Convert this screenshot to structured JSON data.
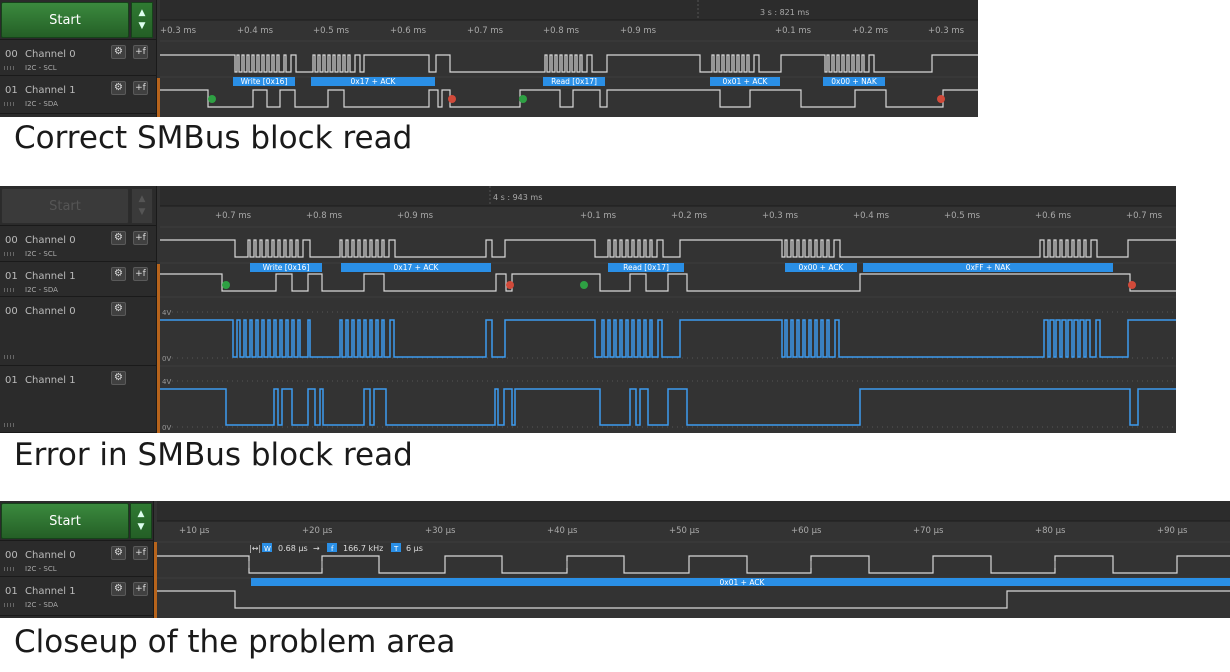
{
  "panel1": {
    "start_label": "Start",
    "timestamp": "3 s : 821 ms",
    "ticks": [
      "+0.3 ms",
      "+0.4 ms",
      "+0.5 ms",
      "+0.6 ms",
      "+0.7 ms",
      "+0.8 ms",
      "+0.9 ms",
      "+0.1 ms",
      "+0.2 ms",
      "+0.3 ms"
    ],
    "channels": [
      {
        "num": "00",
        "name": "Channel 0",
        "sub": "I2C - SCL"
      },
      {
        "num": "01",
        "name": "Channel 1",
        "sub": "I2C - SDA"
      }
    ],
    "annotations": [
      "Write [0x16]",
      "0x17 + ACK",
      "Read [0x17]",
      "0x01 + ACK",
      "0x00 + NAK"
    ],
    "caption": "Correct SMBus block read"
  },
  "panel2": {
    "start_label": "Start",
    "timestamp": "4 s : 943 ms",
    "ticks": [
      "+0.7 ms",
      "+0.8 ms",
      "+0.9 ms",
      "+0.1 ms",
      "+0.2 ms",
      "+0.3 ms",
      "+0.4 ms",
      "+0.5 ms",
      "+0.6 ms",
      "+0.7 ms"
    ],
    "channels": [
      {
        "num": "00",
        "name": "Channel 0",
        "sub": "I2C - SCL"
      },
      {
        "num": "01",
        "name": "Channel 1",
        "sub": "I2C - SDA"
      },
      {
        "num": "00",
        "name": "Channel 0",
        "sub": ""
      },
      {
        "num": "01",
        "name": "Channel 1",
        "sub": ""
      }
    ],
    "annotations": [
      "Write [0x16]",
      "0x17 + ACK",
      "Read [0x17]",
      "0x00 + ACK",
      "0xFF + NAK"
    ],
    "analog_labels": {
      "high": "4V",
      "low": "0V"
    },
    "caption": "Error in SMBus block read"
  },
  "panel3": {
    "start_label": "Start",
    "ticks": [
      "+10 µs",
      "+20 µs",
      "+30 µs",
      "+40 µs",
      "+50 µs",
      "+60 µs",
      "+70 µs",
      "+80 µs",
      "+90 µs"
    ],
    "channels": [
      {
        "num": "00",
        "name": "Channel 0",
        "sub": "I2C - SCL"
      },
      {
        "num": "01",
        "name": "Channel 1",
        "sub": "I2C - SDA"
      }
    ],
    "measure": {
      "w_label": "W",
      "w_value": "0.68 µs",
      "f_label": "f",
      "f_value": "166.7 kHz",
      "t_label": "T",
      "t_value": "6 µs"
    },
    "annotation": "0x01 + ACK",
    "caption": "Closeup of the problem area"
  },
  "colors": {
    "start_green": "#2f7a32",
    "annotation_blue": "#2a8fe6",
    "trace": "#d8d8d8",
    "analog": "#3d9bf0",
    "start_dot": "#2ea043",
    "stop_dot": "#d14a3a",
    "bg": "#333333"
  },
  "icons": {
    "settings": "gear-icon",
    "add_analyzer": "plus-f-icon",
    "up": "chevron-up-icon",
    "down": "chevron-down-icon"
  }
}
